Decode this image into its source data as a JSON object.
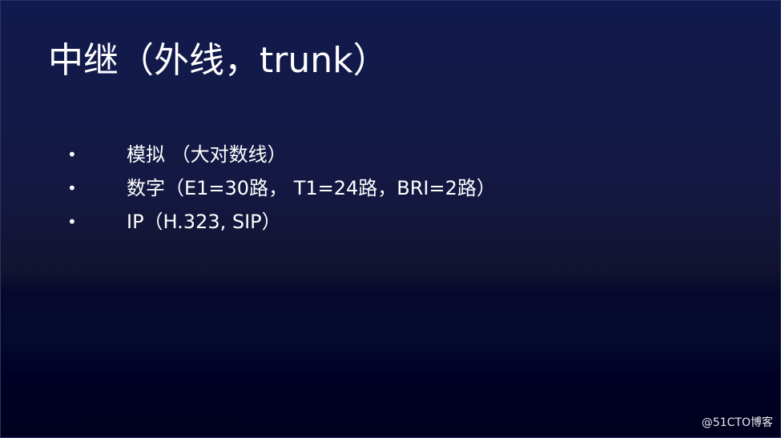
{
  "slide": {
    "title": "中继（外线，trunk）",
    "bullets": [
      {
        "marker": "•",
        "text": "模拟 （大对数线）"
      },
      {
        "marker": "•",
        "text": "数字（E1=30路， T1=24路，BRI=2路）"
      },
      {
        "marker": "•",
        "text": "IP（H.323, SIP）"
      }
    ],
    "watermark": "@51CTO博客"
  },
  "colors": {
    "background_top": "#111a4e",
    "background_bottom": "#00001e",
    "text": "#ffffff"
  }
}
